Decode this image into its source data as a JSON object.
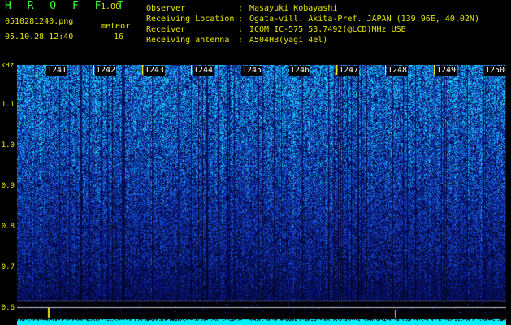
{
  "app": {
    "title": "H R O F F T",
    "version": "1.00",
    "filename": "0510281240.png",
    "datetime": "05.10.28 12:40",
    "meteor_label": "meteor",
    "meteor_count": "16"
  },
  "info": [
    {
      "label": "Observer",
      "sep": ":",
      "value": "Masayuki Kobayashi"
    },
    {
      "label": "Receiving Location",
      "sep": ":",
      "value": "Ogata-vill. Akita-Pref. JAPAN (139.96E, 40.02N)"
    },
    {
      "label": "Receiver",
      "sep": ":",
      "value": "ICOM IC-575 53.7492(@LCD)MHz USB"
    },
    {
      "label": "Receiving antenna",
      "sep": ":",
      "value": "A504HB(yagi 4el)"
    }
  ],
  "axis": {
    "unit": "kHz",
    "y_ticks": [
      "1.1",
      "1.0",
      "0.9",
      "0.8",
      "0.7",
      "0.6"
    ],
    "x_ticks": [
      "1241",
      "1242",
      "1243",
      "1244",
      "1245",
      "1246",
      "1247",
      "1248",
      "1249",
      "1250"
    ]
  },
  "colors": {
    "background": "#000000",
    "text_yellow": "#e6e600",
    "title_green": "#33ff33",
    "spectrum_deep": "#0a1870",
    "spectrum_mid": "#1e50e6",
    "spectrum_high": "#19e6ff",
    "baseline_cyan": "#00ffff"
  }
}
